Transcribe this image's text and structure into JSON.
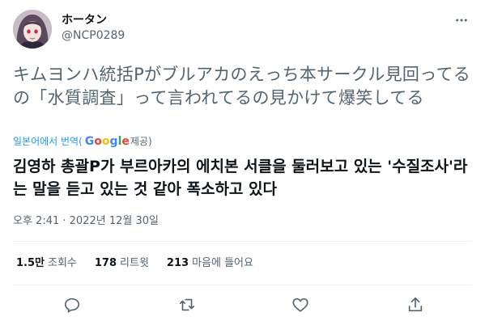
{
  "user": {
    "display_name": "ホータン",
    "handle": "@NCP0289"
  },
  "tweet": {
    "text": "キムヨンハ統括Pがブルアカのえっち本サークル見回ってるの「水質調査」って言われてるの見かけて爆笑してる",
    "translated_from": "일본어에서 번역(",
    "translator": "Google",
    "translator_suffix": " 제공)",
    "translation": "김영하 총괄P가 부르아카의 에치본 서클을 둘러보고 있는 '수질조사'라는 말을 듣고 있는 것 같아 폭소하고 있다",
    "timestamp": "오후 2:41 · 2022년 12월 30일"
  },
  "stats": [
    {
      "count": "1.5만",
      "label": "조회수"
    },
    {
      "count": "178",
      "label": "리트윗"
    },
    {
      "count": "213",
      "label": "마음에 들어요"
    }
  ],
  "icons": {
    "more": "more-icon",
    "reply": "reply-icon",
    "retweet": "retweet-icon",
    "like": "like-icon",
    "share": "share-icon"
  },
  "colors": {
    "text_primary": "#0f1419",
    "text_secondary": "#536471",
    "link_blue": "#1d9bf0",
    "divider": "#eff3f4"
  }
}
